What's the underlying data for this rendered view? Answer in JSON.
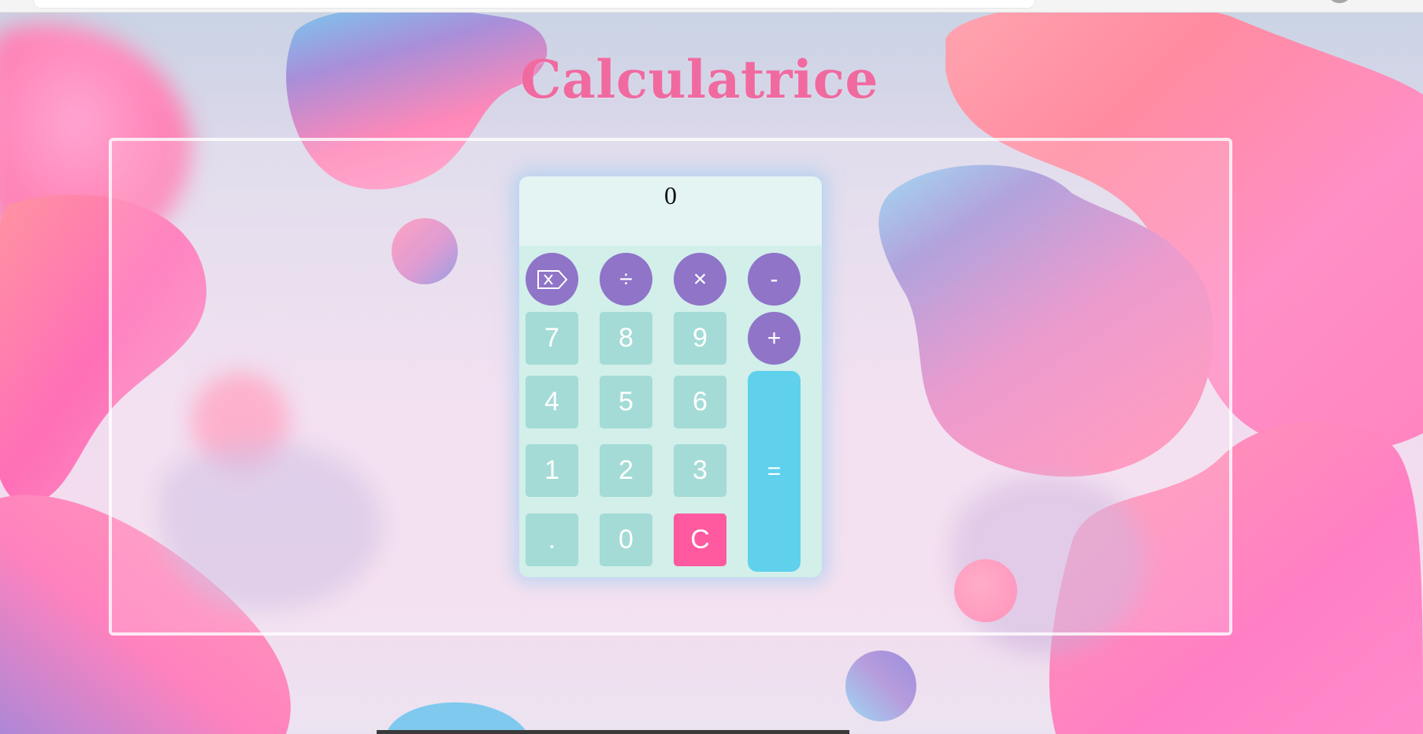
{
  "page": {
    "title": "Calculatrice"
  },
  "display": {
    "value": "0"
  },
  "keys": {
    "backspace": "backspace-icon",
    "divide": "÷",
    "multiply": "×",
    "minus": "-",
    "plus": "+",
    "equals": "=",
    "seven": "7",
    "eight": "8",
    "nine": "9",
    "four": "4",
    "five": "5",
    "six": "6",
    "one": "1",
    "two": "2",
    "three": "3",
    "dot": ".",
    "zero": "0",
    "clear": "C"
  },
  "colors": {
    "title": "#f06aa0",
    "operator_key": "#8f74c8",
    "number_key": "#a4dbd6",
    "clear_key": "#ff5aa0",
    "equals_key": "#5fd1ec",
    "calculator_body": "#d2efea",
    "display": "#e4f4f3"
  }
}
